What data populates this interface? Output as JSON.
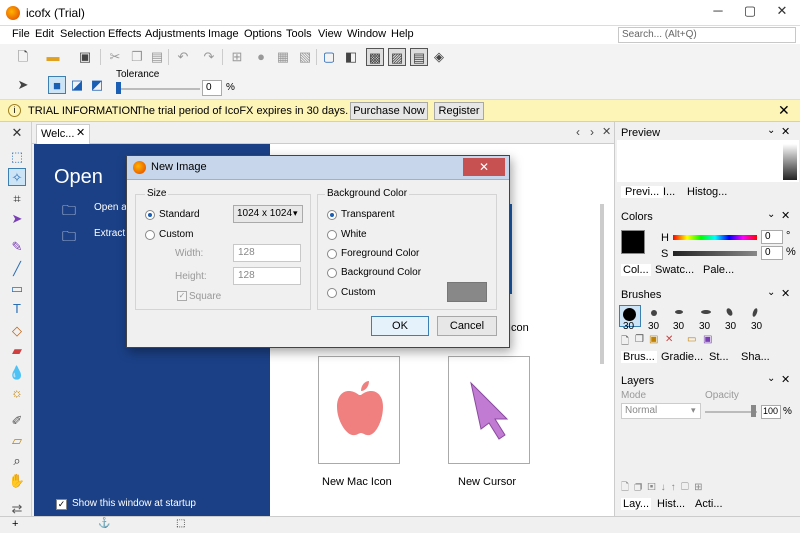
{
  "window": {
    "title": "icofx (Trial)",
    "minimize": "─",
    "maximize": "▢",
    "close": "✕"
  },
  "menu": [
    "File",
    "Edit",
    "Selection",
    "Effects",
    "Adjustments",
    "Image",
    "Options",
    "Tools",
    "View",
    "Window",
    "Help"
  ],
  "search": {
    "placeholder": "Search... (Alt+Q)"
  },
  "toolbar2": {
    "tolerance_label": "Tolerance",
    "tolerance_value": "0",
    "percent": "%"
  },
  "trial": {
    "label": "TRIAL INFORMATION",
    "message": "The trial period of IcoFX expires in 30 days.",
    "purchase": "Purchase Now",
    "register": "Register"
  },
  "doc": {
    "tab": "Welc...",
    "open_title": "Open",
    "open_item1": "Open an",
    "open_item2": "Extract i",
    "show_startup": "Show this window at startup",
    "cards": [
      {
        "label": "New Mac Icon"
      },
      {
        "label": "New Cursor"
      }
    ],
    "icon_text": "Icon"
  },
  "dialog": {
    "title": "New Image",
    "size_group": "Size",
    "standard": "Standard",
    "size_value": "1024 x 1024",
    "custom": "Custom",
    "width_label": "Width:",
    "width_value": "128",
    "height_label": "Height:",
    "height_value": "128",
    "square": "Square",
    "bg_group": "Background Color",
    "bg_options": [
      "Transparent",
      "White",
      "Foreground Color",
      "Background Color",
      "Custom"
    ],
    "ok": "OK",
    "cancel": "Cancel"
  },
  "panels": {
    "preview": {
      "title": "Preview",
      "tabs": [
        "Previ...",
        "I...",
        "Histog..."
      ]
    },
    "colors": {
      "title": "Colors",
      "h_label": "H",
      "h_value": "0",
      "s_label": "S",
      "s_value": "0",
      "percent": "%",
      "deg": "°",
      "tabs": [
        "Col...",
        "Swatc...",
        "Pale..."
      ]
    },
    "brushes": {
      "title": "Brushes",
      "sizes": [
        "30",
        "30",
        "30",
        "30",
        "30",
        "30"
      ],
      "tabs": [
        "Brus...",
        "Gradie...",
        "St...",
        "Sha..."
      ]
    },
    "layers": {
      "title": "Layers",
      "mode_label": "Mode",
      "mode_value": "Normal",
      "opacity_label": "Opacity",
      "opacity_value": "100",
      "percent": "%",
      "tabs": [
        "Lay...",
        "Hist...",
        "Acti..."
      ]
    }
  },
  "colors": {
    "accent": "#1b4086",
    "trial_bg": "#fdf4b8"
  }
}
